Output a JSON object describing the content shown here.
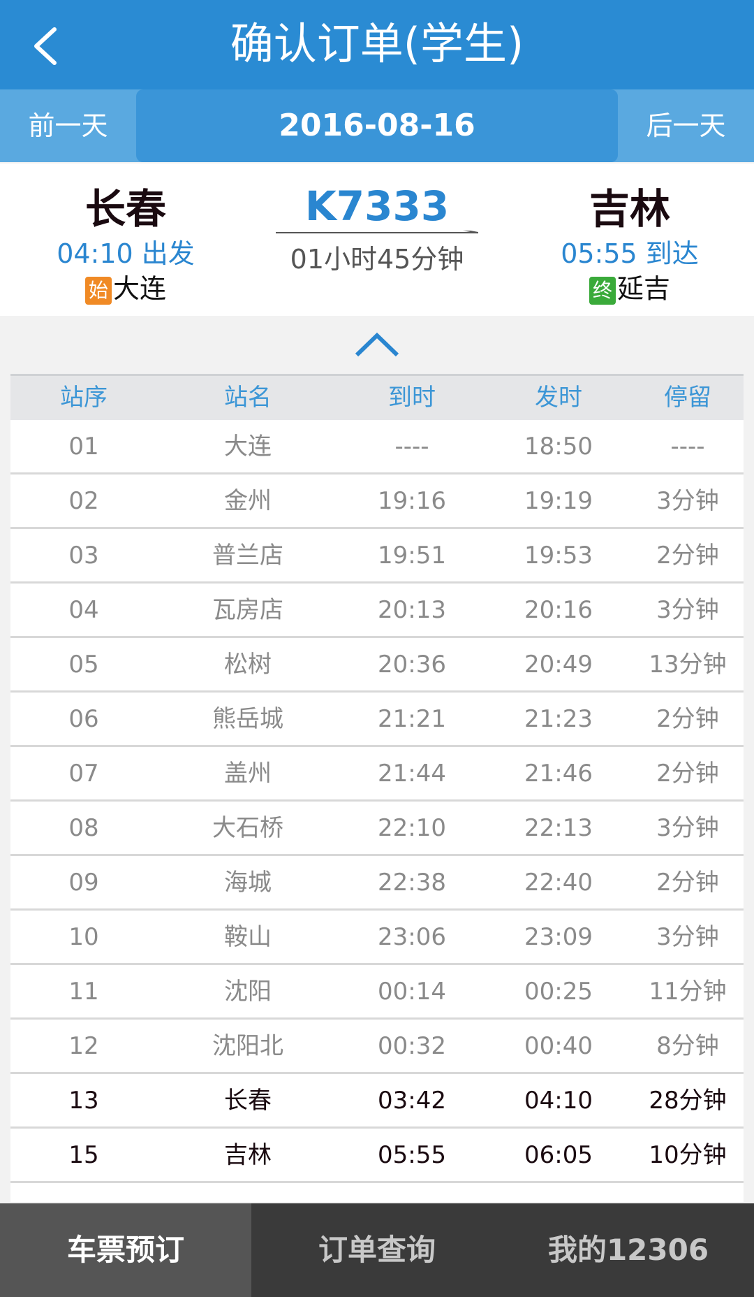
{
  "header": {
    "title": "确认订单(学生)"
  },
  "datebar": {
    "prev_label": "前一天",
    "date": "2016-08-16",
    "next_label": "后一天"
  },
  "train": {
    "number": "K7333",
    "duration": "01小时45分钟",
    "from": {
      "name": "长春",
      "time_label": "04:10 出发",
      "tag": "始",
      "terminal": "大连"
    },
    "to": {
      "name": "吉林",
      "time_label": "05:55 到达",
      "tag": "终",
      "terminal": "延吉"
    }
  },
  "stops": {
    "headers": [
      "站序",
      "站名",
      "到时",
      "发时",
      "停留"
    ],
    "rows": [
      {
        "no": "01",
        "name": "大连",
        "arrive": "----",
        "depart": "18:50",
        "stay": "----",
        "highlight": false
      },
      {
        "no": "02",
        "name": "金州",
        "arrive": "19:16",
        "depart": "19:19",
        "stay": "3分钟",
        "highlight": false
      },
      {
        "no": "03",
        "name": "普兰店",
        "arrive": "19:51",
        "depart": "19:53",
        "stay": "2分钟",
        "highlight": false
      },
      {
        "no": "04",
        "name": "瓦房店",
        "arrive": "20:13",
        "depart": "20:16",
        "stay": "3分钟",
        "highlight": false
      },
      {
        "no": "05",
        "name": "松树",
        "arrive": "20:36",
        "depart": "20:49",
        "stay": "13分钟",
        "highlight": false
      },
      {
        "no": "06",
        "name": "熊岳城",
        "arrive": "21:21",
        "depart": "21:23",
        "stay": "2分钟",
        "highlight": false
      },
      {
        "no": "07",
        "name": "盖州",
        "arrive": "21:44",
        "depart": "21:46",
        "stay": "2分钟",
        "highlight": false
      },
      {
        "no": "08",
        "name": "大石桥",
        "arrive": "22:10",
        "depart": "22:13",
        "stay": "3分钟",
        "highlight": false
      },
      {
        "no": "09",
        "name": "海城",
        "arrive": "22:38",
        "depart": "22:40",
        "stay": "2分钟",
        "highlight": false
      },
      {
        "no": "10",
        "name": "鞍山",
        "arrive": "23:06",
        "depart": "23:09",
        "stay": "3分钟",
        "highlight": false
      },
      {
        "no": "11",
        "name": "沈阳",
        "arrive": "00:14",
        "depart": "00:25",
        "stay": "11分钟",
        "highlight": false
      },
      {
        "no": "12",
        "name": "沈阳北",
        "arrive": "00:32",
        "depart": "00:40",
        "stay": "8分钟",
        "highlight": false
      },
      {
        "no": "13",
        "name": "长春",
        "arrive": "03:42",
        "depart": "04:10",
        "stay": "28分钟",
        "highlight": true
      },
      {
        "no": "15",
        "name": "吉林",
        "arrive": "05:55",
        "depart": "06:05",
        "stay": "10分钟",
        "highlight": true
      }
    ]
  },
  "bottom_nav": {
    "items": [
      {
        "label": "车票预订",
        "active": true
      },
      {
        "label": "订单查询",
        "active": false
      },
      {
        "label": "我的12306",
        "active": false
      }
    ]
  },
  "colors": {
    "header_bg": "#2a8bd3",
    "datebar_bg": "#5aa9e0",
    "accent_blue": "#2a86d0",
    "start_tag": "#f08a25",
    "end_tag": "#3aaa3a",
    "nav_bg": "#3a3a3a"
  }
}
